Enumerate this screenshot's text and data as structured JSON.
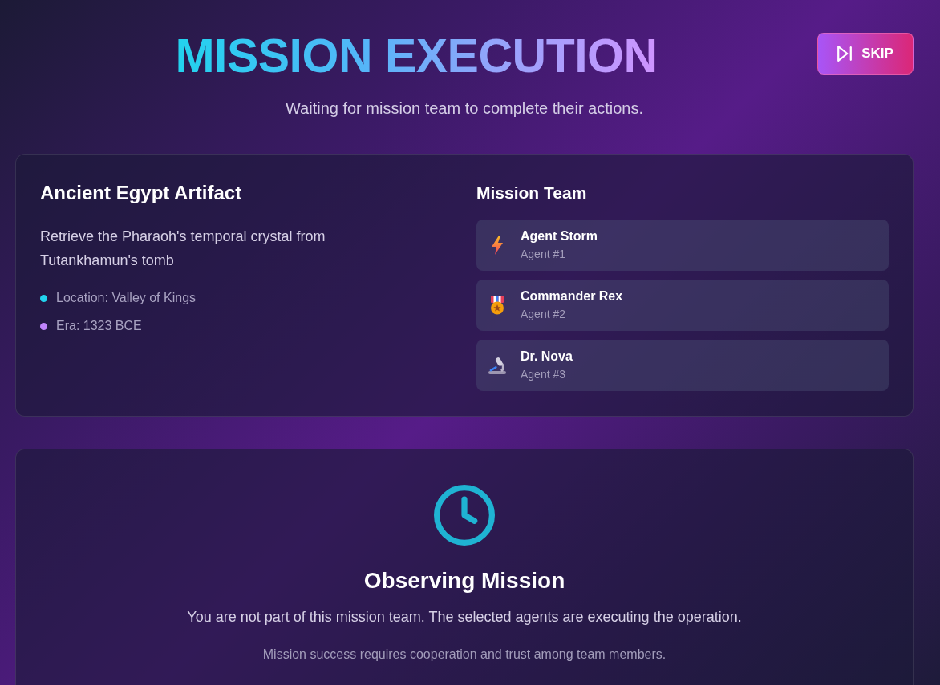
{
  "header": {
    "title": "MISSION EXECUTION",
    "skip_button": {
      "label": "SKIP"
    },
    "subtitle": "Waiting for mission team to complete their actions."
  },
  "mission": {
    "title": "Ancient Egypt Artifact",
    "description": "Retrieve the Pharaoh's temporal crystal from Tutankhamun's tomb",
    "details": [
      {
        "text": "Location: Valley of Kings",
        "color": "#22d3ee"
      },
      {
        "text": "Era: 1323 BCE",
        "color": "#c084fc"
      }
    ]
  },
  "team": {
    "heading": "Mission Team",
    "members": [
      {
        "name": "Agent Storm",
        "role": "Agent #1",
        "kind": "lightning"
      },
      {
        "name": "Commander Rex",
        "role": "Agent #2",
        "kind": "medal"
      },
      {
        "name": "Dr. Nova",
        "role": "Agent #3",
        "kind": "microscope"
      }
    ]
  },
  "status": {
    "title": "Observing Mission",
    "message": "You are not part of this mission team. The selected agents are executing the operation.",
    "note": "Mission success requires cooperation and trust among team members."
  }
}
